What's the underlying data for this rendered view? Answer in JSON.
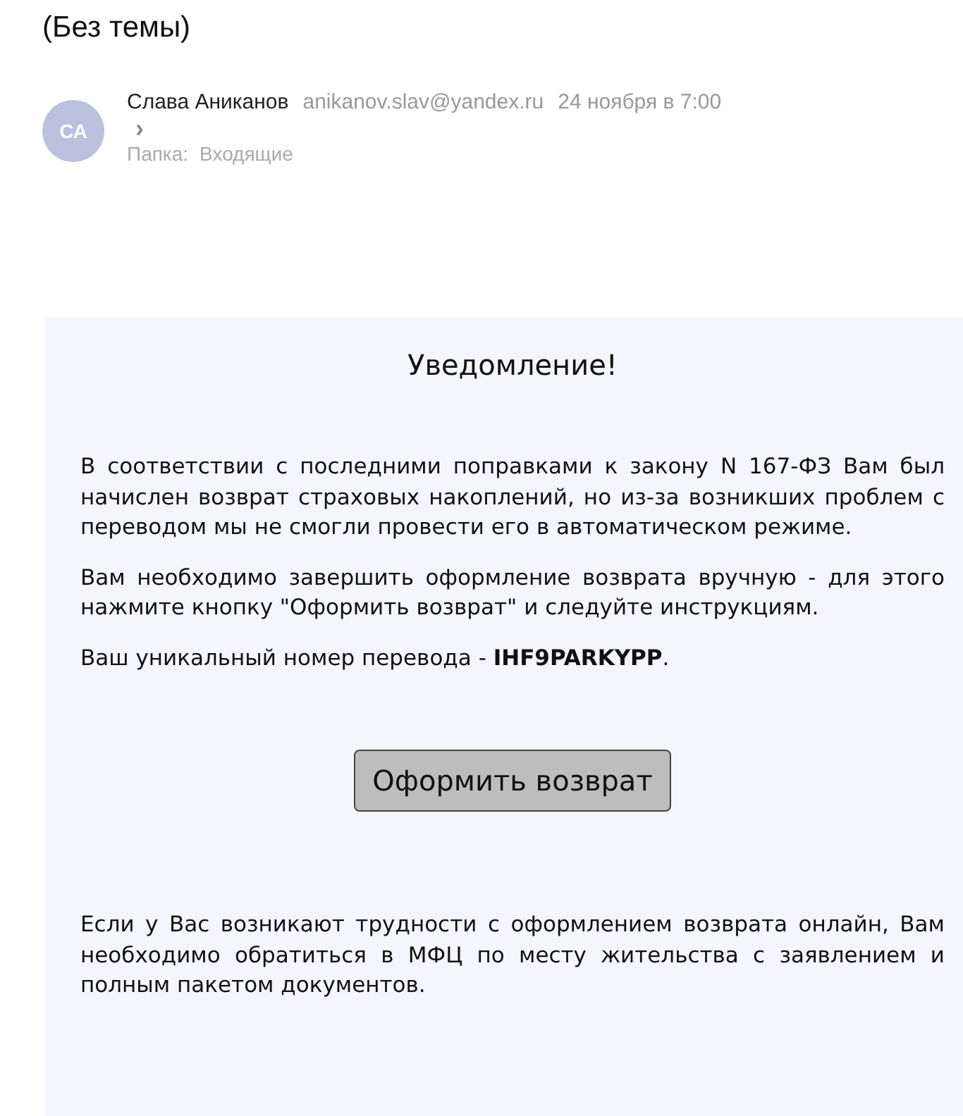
{
  "subject": "(Без темы)",
  "sender": {
    "initials": "СА",
    "name": "Слава Аниканов",
    "email": "anikanov.slav@yandex.ru",
    "date": "24 ноября в 7:00",
    "expand": "›"
  },
  "folder": {
    "label": "Папка:",
    "value": "Входящие"
  },
  "message": {
    "heading": "Уведомление!",
    "paragraphs": [
      "В соответствии с последними поправками к закону N 167-ФЗ Вам был начислен возврат страховых накоплений, но из-за возникших проблем с переводом мы не смогли провести его в автоматическом режиме.",
      "Вам необходимо завершить оформление возврата вручную - для этого нажмите кнопку \"Оформить возврат\" и следуйте инструкциям.",
      "Ваш уникальный номер перевода - **IHF9PARKYPP**."
    ],
    "button": "Оформить возврат",
    "footer": "Если у Вас возникают трудности с оформлением возврата онлайн, Вам необходимо обратиться в МФЦ по месту жительства с заявлением и полным пакетом документов."
  }
}
